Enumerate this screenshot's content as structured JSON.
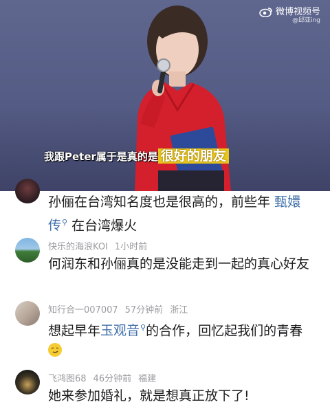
{
  "video": {
    "watermark_brand": "微博视频号",
    "watermark_handle": "@邱亚ing",
    "subtitle_plain": "我跟Peter属于是真的是",
    "subtitle_highlight": "很好的朋友"
  },
  "comments": [
    {
      "text_a": "孙俪在台湾知名度也是很高的，前些年",
      "link": "甄嬛传",
      "text_b": "在台湾爆火"
    },
    {
      "username": "快乐的海浪KOI",
      "time": "1小时前",
      "text": "何润东和孙俪真的是没能走到一起的真心好友"
    },
    {
      "username": "知行合一007007",
      "time": "57分钟前",
      "location": "浙江",
      "text_a": "想起早年",
      "link": "玉观音",
      "text_b": "的合作，回忆起我们的青春"
    },
    {
      "username": "飞鸿图68",
      "time": "46分钟前",
      "location": "福建",
      "text": "她来参加婚礼，就是想真正放下了!"
    }
  ],
  "icons": {
    "link_search": "search-icon",
    "emoji": "smirk-emoji-icon"
  }
}
